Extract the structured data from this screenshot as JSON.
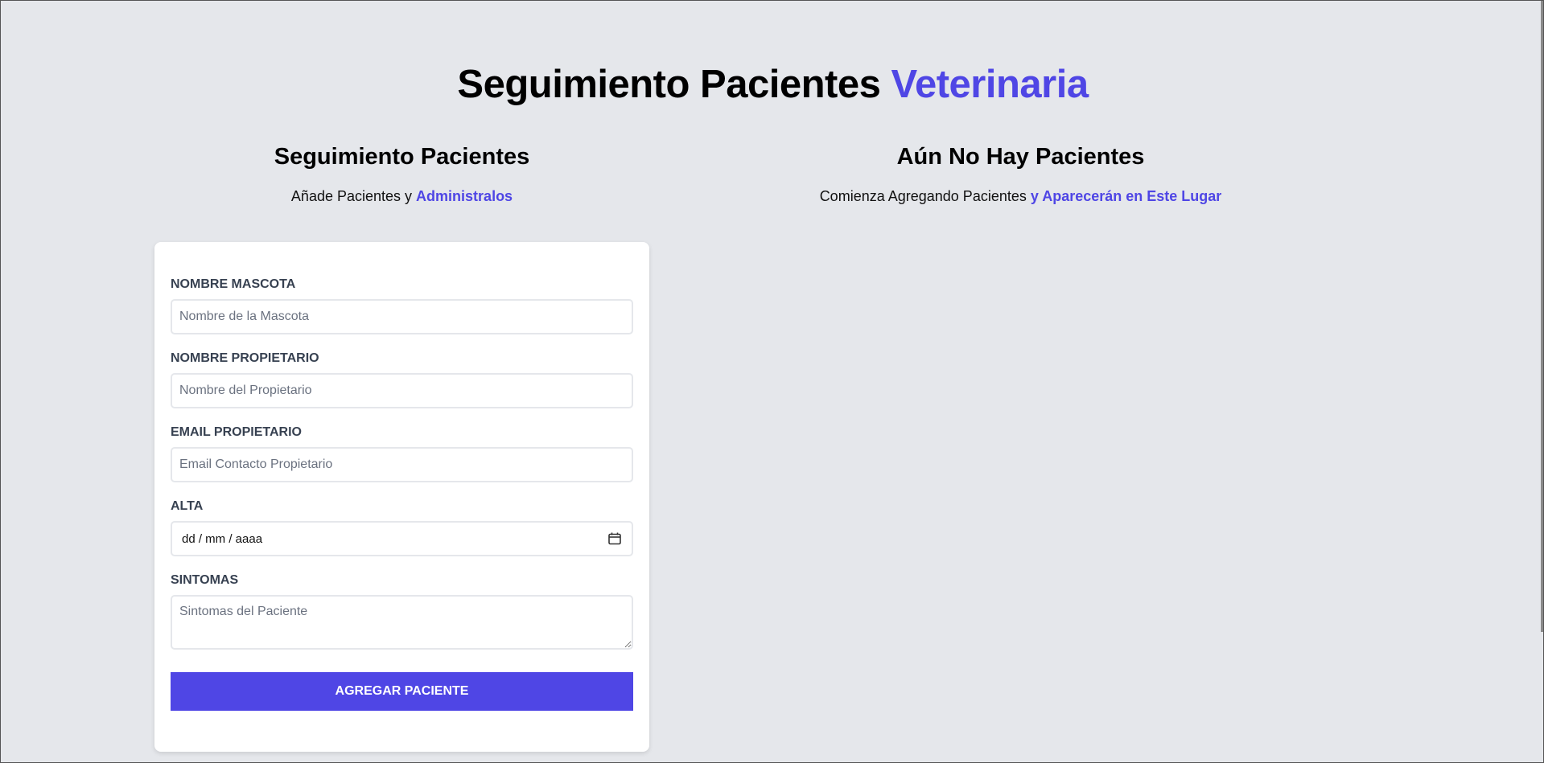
{
  "header": {
    "title_main": "Seguimiento Pacientes",
    "title_accent": "Veterinaria"
  },
  "form_section": {
    "title": "Seguimiento Pacientes",
    "subtitle_plain": "Añade Pacientes y",
    "subtitle_accent": "Administralos"
  },
  "list_section": {
    "title": "Aún No Hay Pacientes",
    "subtitle_plain": "Comienza Agregando Pacientes",
    "subtitle_accent": "y Aparecerán en Este Lugar"
  },
  "form": {
    "fields": [
      {
        "label": "Nombre Mascota",
        "placeholder": "Nombre de la Mascota"
      },
      {
        "label": "Nombre Propietario",
        "placeholder": "Nombre del Propietario"
      },
      {
        "label": "Email Propietario",
        "placeholder": "Email Contacto Propietario"
      }
    ],
    "date_field": {
      "label": "Alta",
      "value": "dd / mm / aaaa",
      "icon": "calendar-icon"
    },
    "symptoms_field": {
      "label": "Sintomas",
      "placeholder": "Sintomas del Paciente"
    },
    "submit_label": "Agregar Paciente"
  },
  "colors": {
    "accent": "#4f46e5",
    "background": "#e5e7eb",
    "card": "#ffffff"
  }
}
